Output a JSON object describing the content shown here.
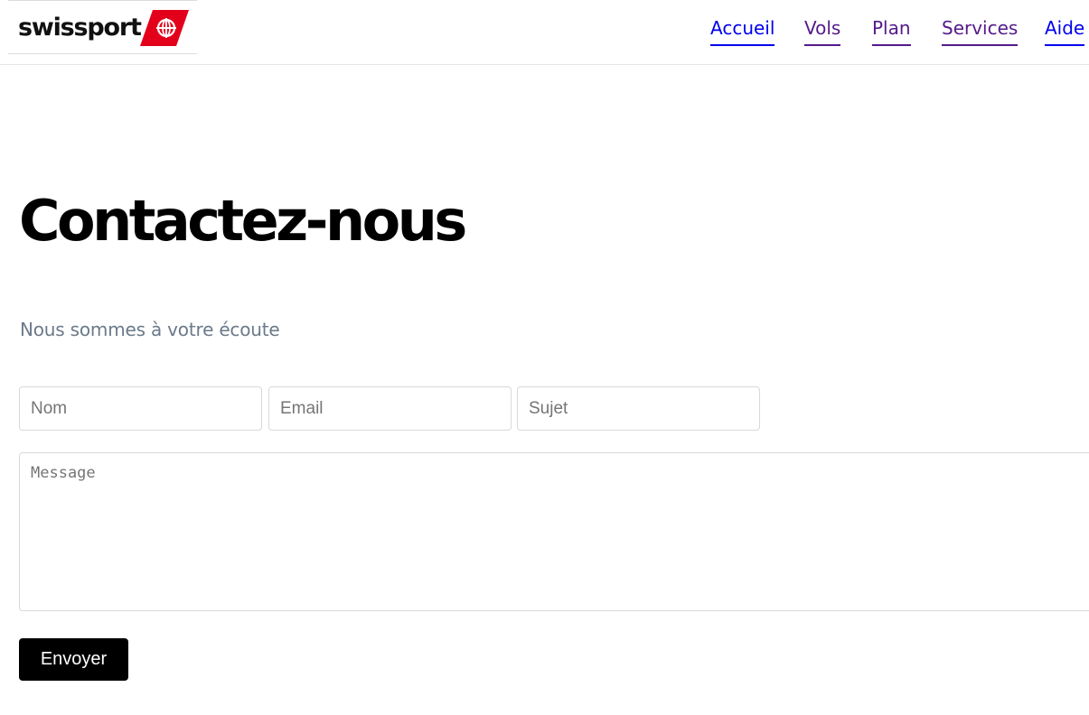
{
  "header": {
    "logo_text": "swissport",
    "nav": [
      {
        "label": "Accueil",
        "visited": false
      },
      {
        "label": "Vols",
        "visited": true
      },
      {
        "label": "Plan",
        "visited": true
      },
      {
        "label": "Services",
        "visited": true
      },
      {
        "label": "Aide",
        "visited": false
      }
    ]
  },
  "main": {
    "title": "Contactez-nous",
    "subtitle": "Nous sommes à votre écoute"
  },
  "form": {
    "name_placeholder": "Nom",
    "email_placeholder": "Email",
    "subject_placeholder": "Sujet",
    "message_placeholder": "Message",
    "submit_label": "Envoyer"
  },
  "colors": {
    "brand_red": "#e3001b",
    "link_blue": "#0000ee",
    "link_visited": "#551a8b",
    "subtitle_gray": "#6b7a89",
    "button_bg": "#000000"
  },
  "icons": {
    "logo_mark": "swissport-globe-logo-icon"
  }
}
